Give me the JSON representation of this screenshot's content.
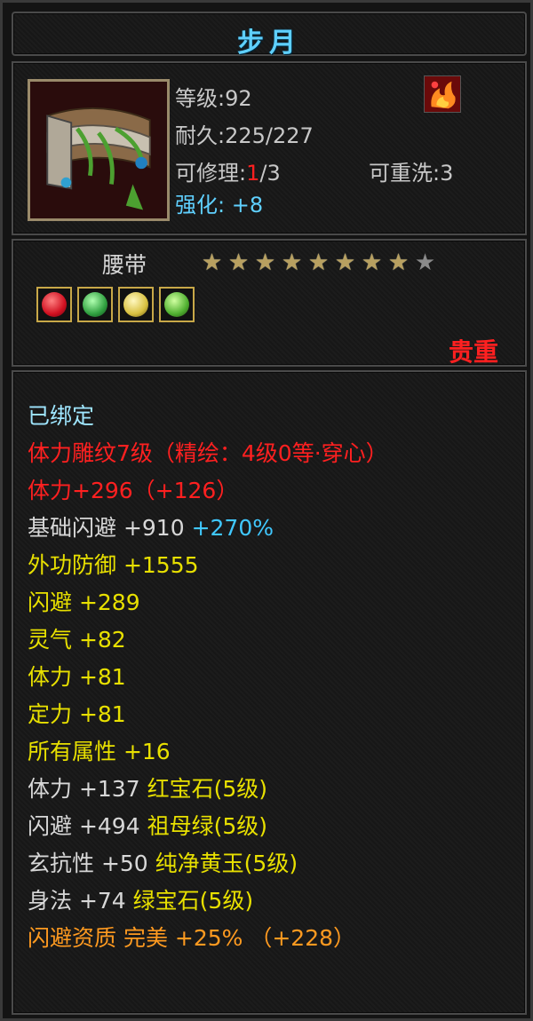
{
  "title": "步月",
  "item": {
    "level": "等级:92",
    "durability": "耐久:225/227",
    "repair_prefix": "可修理:",
    "repair_current": "1",
    "repair_suffix": "/3",
    "rewash": "可重洗:3",
    "enhance_label": "强化:",
    "enhance_value": "+8",
    "type": "腰带",
    "rarity": "贵重",
    "stars_total": 9,
    "stars_filled": 8,
    "icon": "belt-icon",
    "badge_icon": "flame-icon"
  },
  "gems": [
    {
      "icon": "red-gem-icon",
      "color": "#d01020"
    },
    {
      "icon": "green-gem-icon",
      "color": "#30a040"
    },
    {
      "icon": "yellow-gem-icon",
      "color": "#d8c040"
    },
    {
      "icon": "emerald-gem-icon",
      "color": "#50b030"
    }
  ],
  "attributes": {
    "bound": "已绑定",
    "engrave": "体力雕纹7级（精绘：4级0等·穿心）",
    "stamina_engrave": "体力+296（+126）",
    "base_dodge": "基础闪避 +910",
    "base_dodge_pct": "+270%",
    "ext_defense": "外功防御 +1555",
    "dodge": "闪避 +289",
    "spirit": "灵气 +82",
    "stamina": "体力 +81",
    "focus": "定力 +81",
    "all_attr": "所有属性 +16",
    "gem_stamina": "体力 +137",
    "gem_stamina_name": "红宝石(5级)",
    "gem_dodge": "闪避 +494",
    "gem_dodge_name": "祖母绿(5级)",
    "gem_resist": "玄抗性 +50",
    "gem_resist_name": "纯净黄玉(5级)",
    "gem_agility": "身法 +74",
    "gem_agility_name": "绿宝石(5级)",
    "quality": "闪避资质  完美 +25% （+228）"
  }
}
